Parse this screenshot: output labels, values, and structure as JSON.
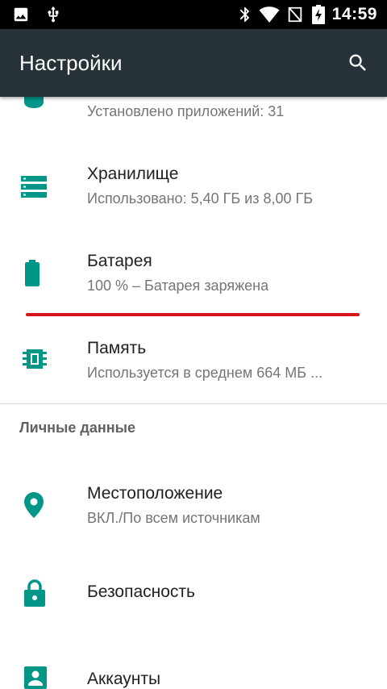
{
  "status_bar": {
    "time": "14:59",
    "icons": [
      "image-icon",
      "usb-icon",
      "bluetooth-icon",
      "wifi-icon",
      "no-sim-icon",
      "battery-charging-icon"
    ]
  },
  "app_bar": {
    "title": "Настройки",
    "search_icon": "search-icon",
    "background": "#263238"
  },
  "device_items": [
    {
      "name": "apps",
      "title": "",
      "summary": "Установлено приложений: 31",
      "icon": "apps-icon"
    },
    {
      "name": "storage",
      "title": "Хранилище",
      "summary": "Использовано: 5,40 ГБ из 8,00 ГБ",
      "icon": "storage-icon"
    },
    {
      "name": "battery",
      "title": "Батарея",
      "summary": "100 % – Батарея заряжена",
      "icon": "battery-icon"
    },
    {
      "name": "memory",
      "title": "Память",
      "summary": "Используется в среднем 664 МБ ...",
      "icon": "memory-icon"
    }
  ],
  "personal_section": {
    "header": "Личные данные",
    "items": [
      {
        "name": "location",
        "title": "Местоположение",
        "summary": "ВКЛ./По всем источникам",
        "icon": "location-pin-icon"
      },
      {
        "name": "security",
        "title": "Безопасность",
        "icon": "lock-icon"
      },
      {
        "name": "accounts",
        "title": "Аккаунты",
        "icon": "account-icon"
      }
    ]
  },
  "colors": {
    "accent": "#009688",
    "highlight_line": "#d5141c",
    "title_text": "#212121",
    "summary_text": "#757575"
  }
}
